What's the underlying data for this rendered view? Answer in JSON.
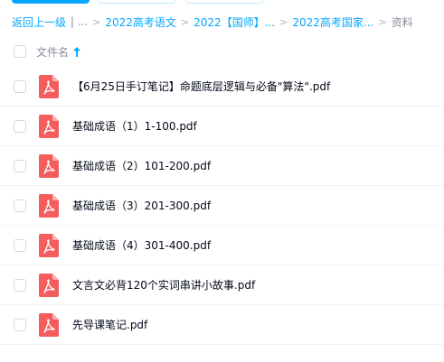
{
  "breadcrumb": {
    "back": "返回上一级",
    "sep_pipe": "|",
    "ellipsis": "...",
    "items": [
      "2022高考语文",
      "2022【国师】...",
      "2022高考国家...",
      "资料"
    ]
  },
  "header": {
    "name_col": "文件名"
  },
  "files": [
    {
      "name": "【6月25日手订笔记】命题底层逻辑与必备\"算法\".pdf",
      "icon": "pdf-icon"
    },
    {
      "name": "基础成语（1）1-100.pdf",
      "icon": "pdf-icon"
    },
    {
      "name": "基础成语（2）101-200.pdf",
      "icon": "pdf-icon"
    },
    {
      "name": "基础成语（3）201-300.pdf",
      "icon": "pdf-icon"
    },
    {
      "name": "基础成语（4）301-400.pdf",
      "icon": "pdf-icon"
    },
    {
      "name": "文言文必背120个实词串讲小故事.pdf",
      "icon": "pdf-icon"
    },
    {
      "name": "先导课笔记.pdf",
      "icon": "pdf-icon"
    }
  ],
  "colors": {
    "accent": "#06a7ff",
    "pdf_red": "#f55d5d",
    "text": "#03081a",
    "muted": "#878c9c"
  }
}
